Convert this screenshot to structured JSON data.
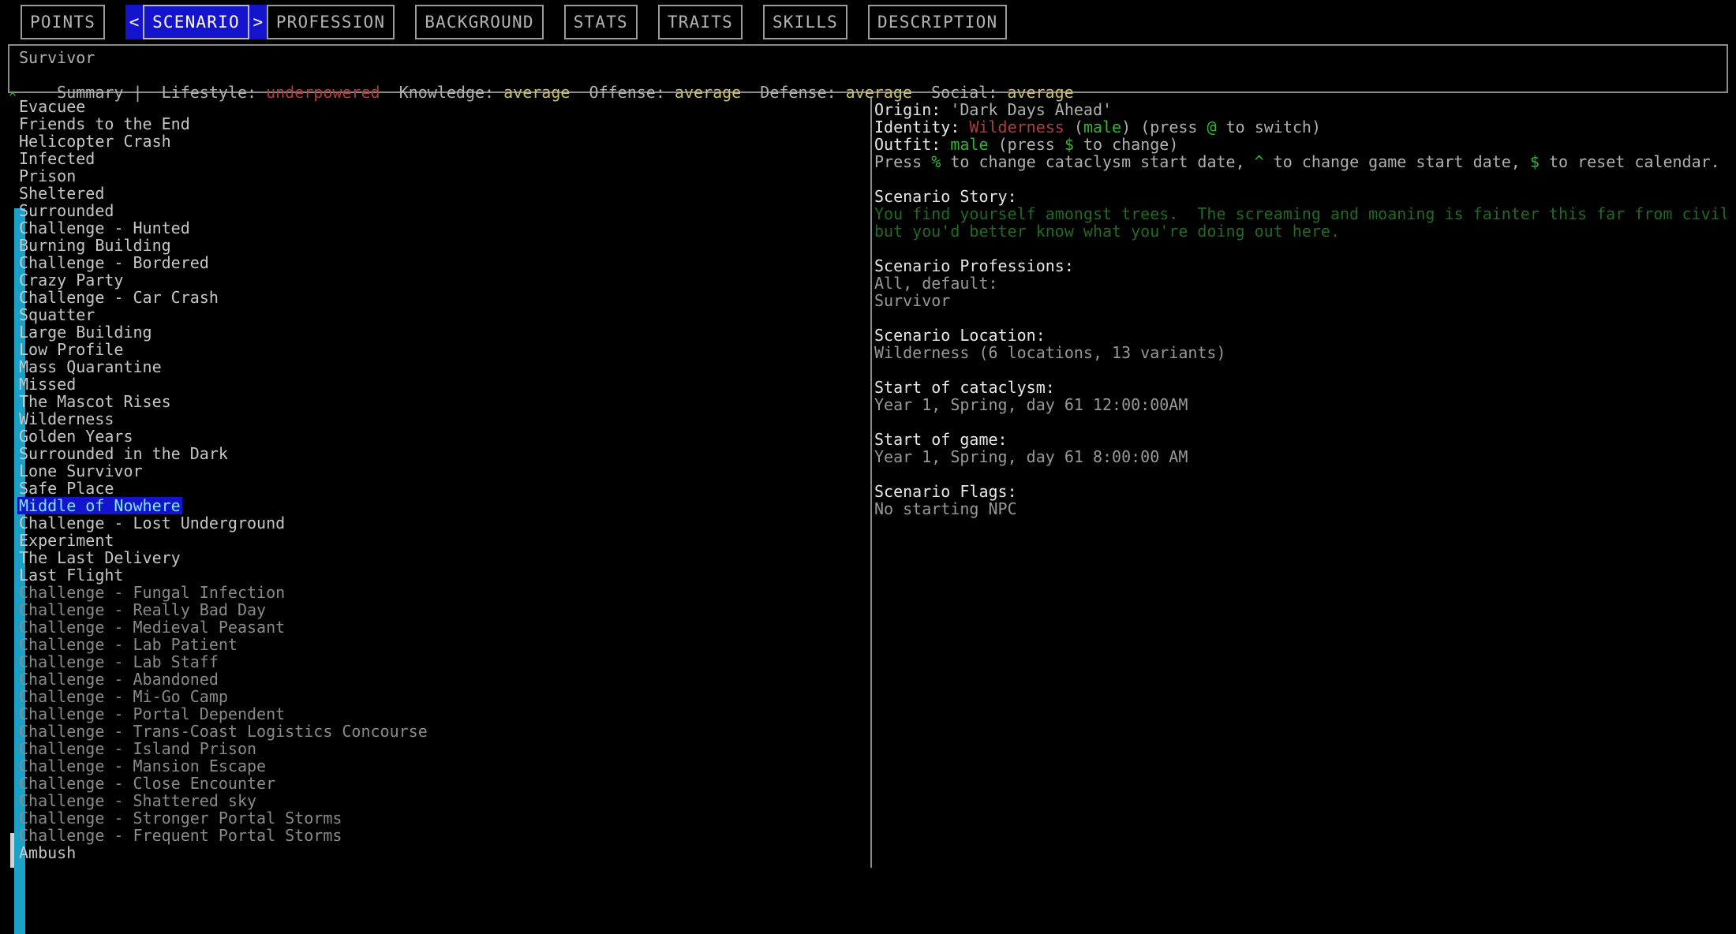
{
  "window": {
    "app": "Cataclysm: Dark Days Ahead",
    "screen": "Character Creation"
  },
  "tabs": {
    "items": [
      {
        "label": "POINTS",
        "selected": false
      },
      {
        "label": "SCENARIO",
        "selected": true
      },
      {
        "label": "PROFESSION",
        "selected": false
      },
      {
        "label": "BACKGROUND",
        "selected": false
      },
      {
        "label": "STATS",
        "selected": false
      },
      {
        "label": "TRAITS",
        "selected": false
      },
      {
        "label": "SKILLS",
        "selected": false
      },
      {
        "label": "DESCRIPTION",
        "selected": false
      }
    ],
    "prev_arrow": "<",
    "next_arrow": ">"
  },
  "summary": {
    "profession": "Survivor",
    "label": "Summary |",
    "stats": [
      {
        "name": "Lifestyle:",
        "value": "underpowered",
        "color": "#b03c3c"
      },
      {
        "name": "Knowledge:",
        "value": "average",
        "color": "#c9c06a"
      },
      {
        "name": "Offense:",
        "value": "average",
        "color": "#c9c06a"
      },
      {
        "name": "Defense:",
        "value": "average",
        "color": "#c9c06a"
      },
      {
        "name": "Social:",
        "value": "average",
        "color": "#c9c06a"
      }
    ]
  },
  "scenario_list": {
    "scroll_up_glyph": "^",
    "selected_index": 23,
    "items": [
      {
        "label": "Evacuee",
        "dim": false
      },
      {
        "label": "Friends to the End",
        "dim": false
      },
      {
        "label": "Helicopter Crash",
        "dim": false
      },
      {
        "label": "Infected",
        "dim": false
      },
      {
        "label": "Prison",
        "dim": false
      },
      {
        "label": "Sheltered",
        "dim": false
      },
      {
        "label": "Surrounded",
        "dim": false
      },
      {
        "label": "Challenge - Hunted",
        "dim": false
      },
      {
        "label": "Burning Building",
        "dim": false
      },
      {
        "label": "Challenge - Bordered",
        "dim": false
      },
      {
        "label": "Crazy Party",
        "dim": false
      },
      {
        "label": "Challenge - Car Crash",
        "dim": false
      },
      {
        "label": "Squatter",
        "dim": false
      },
      {
        "label": "Large Building",
        "dim": false
      },
      {
        "label": "Low Profile",
        "dim": false
      },
      {
        "label": "Mass Quarantine",
        "dim": false
      },
      {
        "label": "Missed",
        "dim": false
      },
      {
        "label": "The Mascot Rises",
        "dim": false
      },
      {
        "label": "Wilderness",
        "dim": false
      },
      {
        "label": "Golden Years",
        "dim": false
      },
      {
        "label": "Surrounded in the Dark",
        "dim": false
      },
      {
        "label": "Lone Survivor",
        "dim": false
      },
      {
        "label": "Safe Place",
        "dim": false
      },
      {
        "label": "Middle of Nowhere",
        "dim": false
      },
      {
        "label": "Challenge - Lost Underground",
        "dim": false
      },
      {
        "label": "Experiment",
        "dim": false
      },
      {
        "label": "The Last Delivery",
        "dim": false
      },
      {
        "label": "Last Flight",
        "dim": false
      },
      {
        "label": "Challenge - Fungal Infection",
        "dim": true
      },
      {
        "label": "Challenge - Really Bad Day",
        "dim": true
      },
      {
        "label": "Challenge - Medieval Peasant",
        "dim": true
      },
      {
        "label": "Challenge - Lab Patient",
        "dim": true
      },
      {
        "label": "Challenge - Lab Staff",
        "dim": true
      },
      {
        "label": "Challenge - Abandoned",
        "dim": true
      },
      {
        "label": "Challenge - Mi-Go Camp",
        "dim": true
      },
      {
        "label": "Challenge - Portal Dependent",
        "dim": true
      },
      {
        "label": "Challenge - Trans-Coast Logistics Concourse",
        "dim": true
      },
      {
        "label": "Challenge - Island Prison",
        "dim": true
      },
      {
        "label": "Challenge - Mansion Escape",
        "dim": true
      },
      {
        "label": "Challenge - Close Encounter",
        "dim": true
      },
      {
        "label": "Challenge - Shattered sky",
        "dim": true
      },
      {
        "label": "Challenge - Stronger Portal Storms",
        "dim": true
      },
      {
        "label": "Challenge - Frequent Portal Storms",
        "dim": true
      },
      {
        "label": "Ambush",
        "dim": false
      }
    ]
  },
  "details": {
    "origin_label": "Origin:",
    "origin_value": "'Dark Days Ahead'",
    "identity_label": "Identity:",
    "identity_name": "Wilderness",
    "identity_gender": "male",
    "identity_hint_pre": "(press ",
    "identity_hint_key": "@",
    "identity_hint_post": " to switch)",
    "outfit_label": "Outfit:",
    "outfit_value": "male",
    "outfit_hint_pre": "(press ",
    "outfit_hint_key": "$",
    "outfit_hint_post": " to change)",
    "calendar_hint_1": "Press ",
    "calendar_key_1": "%",
    "calendar_hint_2": " to change cataclysm start date, ",
    "calendar_key_2": "^",
    "calendar_hint_3": " to change game start date, ",
    "calendar_key_3": "$",
    "calendar_hint_4": " to reset calendar.",
    "story_heading": "Scenario Story:",
    "story_line1": "You find yourself amongst trees.  The screaming and moaning is fainter this far from civilization,",
    "story_line2": "but you'd better know what you're doing out here.",
    "professions_heading": "Scenario Professions:",
    "professions_line1": "All, default:",
    "professions_line2": "Survivor",
    "location_heading": "Scenario Location:",
    "location_value": "Wilderness (6 locations, 13 variants)",
    "cataclysm_heading": "Start of cataclysm:",
    "cataclysm_value": "Year 1, Spring, day 61 12:00:00AM",
    "gamestart_heading": "Start of game:",
    "gamestart_value": "Year 1, Spring, day 61 8:00:00 AM",
    "flags_heading": "Scenario Flags:",
    "flags_value": "No starting NPC"
  }
}
